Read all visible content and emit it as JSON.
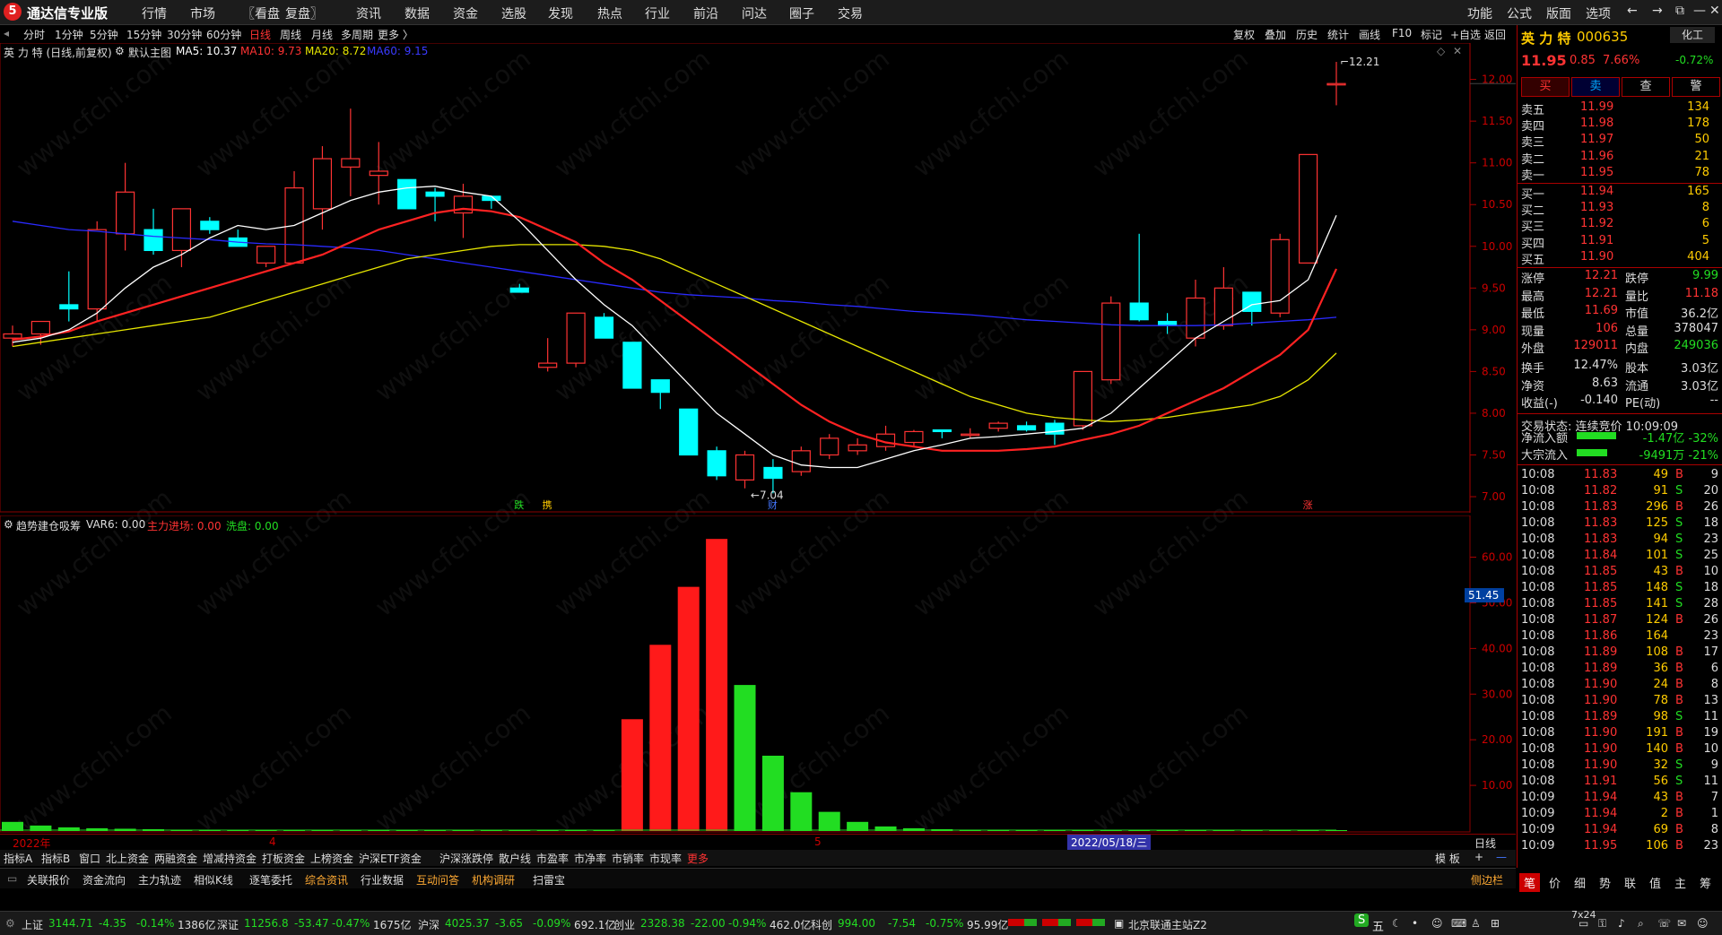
{
  "app": {
    "title": "通达信专业版",
    "logo_letter": "5"
  },
  "menu": [
    "行情",
    "市场",
    "〖看盘",
    "复盘〗",
    "资讯",
    "数据",
    "资金",
    "选股",
    "发现",
    "热点",
    "行业",
    "前沿",
    "问达",
    "圈子",
    "交易"
  ],
  "right_menu": [
    "功能",
    "公式",
    "版面",
    "选项"
  ],
  "window_controls": {
    "back": "←",
    "fwd": "→",
    "restore": "⧉",
    "min": "—",
    "max": "□",
    "close": "✕"
  },
  "periods": [
    "分时",
    "1分钟",
    "5分钟",
    "15分钟",
    "30分钟",
    "60分钟",
    "日线",
    "周线",
    "月线",
    "多周期",
    "更多 〉"
  ],
  "active_period": "日线",
  "toolbar_right": [
    "复权",
    "叠加",
    "历史",
    "统计",
    "画线",
    "F10",
    "标记",
    "+自选",
    "返回"
  ],
  "main_indicator": {
    "name": "英 力 特 (日线,前复权)",
    "template": "默认主图",
    "ma5": "MA5: 10.37",
    "ma10": "MA10: 9.73",
    "ma20": "MA20: 8.72",
    "ma60": "MA60: 9.15"
  },
  "colors": {
    "up": "#ff3333",
    "down": "#00ffff",
    "ma5": "#ffffff",
    "ma10": "#ff2222",
    "ma20": "#e6e600",
    "ma60": "#2a2aff",
    "vol_up": "#ff1a1a",
    "vol_down": "#22dd22",
    "accent": "#cc0000"
  },
  "chart_data": [
    {
      "type": "candlestick",
      "title": "英 力 特 (日线,前复权)",
      "ylim": [
        6.85,
        12.35
      ],
      "yticks": [
        7.0,
        7.5,
        8.0,
        8.5,
        9.0,
        9.5,
        10.0,
        10.5,
        11.0,
        11.5,
        12.0
      ],
      "ytick_labels": [
        "7.00",
        "7.50",
        "8.00",
        "8.50",
        "9.00",
        "9.50",
        "10.00",
        "10.50",
        "11.00",
        "11.50",
        "12.00"
      ],
      "annotations": [
        {
          "text": "12.21",
          "label": "high"
        },
        {
          "text": "←7.04",
          "label": "low"
        }
      ],
      "markers": [
        "跌",
        "携",
        "财",
        "涨"
      ],
      "x_labels": [
        "2022年",
        "4",
        "5",
        "2022/05/18/三"
      ],
      "candles": [
        {
          "o": 8.9,
          "h": 9.05,
          "l": 8.8,
          "c": 8.95
        },
        {
          "o": 8.95,
          "h": 9.05,
          "l": 8.82,
          "c": 9.1
        },
        {
          "o": 9.3,
          "h": 9.7,
          "l": 9.1,
          "c": 9.25
        },
        {
          "o": 9.25,
          "h": 10.3,
          "l": 9.1,
          "c": 10.2
        },
        {
          "o": 10.15,
          "h": 11.0,
          "l": 9.95,
          "c": 10.65
        },
        {
          "o": 10.2,
          "h": 10.45,
          "l": 9.9,
          "c": 9.95
        },
        {
          "o": 9.95,
          "h": 10.45,
          "l": 9.75,
          "c": 10.45
        },
        {
          "o": 10.3,
          "h": 10.35,
          "l": 10.15,
          "c": 10.2
        },
        {
          "o": 10.1,
          "h": 10.2,
          "l": 10.0,
          "c": 10.0
        },
        {
          "o": 9.8,
          "h": 10.0,
          "l": 9.75,
          "c": 10.0
        },
        {
          "o": 9.8,
          "h": 10.9,
          "l": 9.8,
          "c": 10.7
        },
        {
          "o": 10.45,
          "h": 11.2,
          "l": 10.2,
          "c": 11.05
        },
        {
          "o": 10.95,
          "h": 11.65,
          "l": 10.6,
          "c": 11.05
        },
        {
          "o": 10.85,
          "h": 11.25,
          "l": 10.5,
          "c": 10.9
        },
        {
          "o": 10.8,
          "h": 10.8,
          "l": 10.45,
          "c": 10.45
        },
        {
          "o": 10.65,
          "h": 10.7,
          "l": 10.3,
          "c": 10.6
        },
        {
          "o": 10.4,
          "h": 10.75,
          "l": 10.1,
          "c": 10.6
        },
        {
          "o": 10.6,
          "h": 10.6,
          "l": 10.45,
          "c": 10.55
        },
        {
          "o": 9.5,
          "h": 9.55,
          "l": 9.45,
          "c": 9.45
        },
        {
          "o": 8.55,
          "h": 8.9,
          "l": 8.5,
          "c": 8.6
        },
        {
          "o": 8.6,
          "h": 9.2,
          "l": 8.55,
          "c": 9.2
        },
        {
          "o": 9.15,
          "h": 9.2,
          "l": 8.9,
          "c": 8.9
        },
        {
          "o": 8.85,
          "h": 8.85,
          "l": 8.3,
          "c": 8.3
        },
        {
          "o": 8.4,
          "h": 8.4,
          "l": 8.05,
          "c": 8.25
        },
        {
          "o": 8.05,
          "h": 8.05,
          "l": 7.5,
          "c": 7.5
        },
        {
          "o": 7.55,
          "h": 7.6,
          "l": 7.2,
          "c": 7.25
        },
        {
          "o": 7.2,
          "h": 7.55,
          "l": 7.1,
          "c": 7.5
        },
        {
          "o": 7.35,
          "h": 7.45,
          "l": 7.04,
          "c": 7.22
        },
        {
          "o": 7.3,
          "h": 7.6,
          "l": 7.25,
          "c": 7.55
        },
        {
          "o": 7.5,
          "h": 7.75,
          "l": 7.45,
          "c": 7.7
        },
        {
          "o": 7.55,
          "h": 7.7,
          "l": 7.5,
          "c": 7.62
        },
        {
          "o": 7.6,
          "h": 7.85,
          "l": 7.55,
          "c": 7.75
        },
        {
          "o": 7.65,
          "h": 7.8,
          "l": 7.6,
          "c": 7.78
        },
        {
          "o": 7.8,
          "h": 7.8,
          "l": 7.7,
          "c": 7.78
        },
        {
          "o": 7.75,
          "h": 7.82,
          "l": 7.7,
          "c": 7.75
        },
        {
          "o": 7.82,
          "h": 7.9,
          "l": 7.78,
          "c": 7.88
        },
        {
          "o": 7.85,
          "h": 7.9,
          "l": 7.78,
          "c": 7.8
        },
        {
          "o": 7.88,
          "h": 7.92,
          "l": 7.62,
          "c": 7.75
        },
        {
          "o": 7.85,
          "h": 8.5,
          "l": 7.8,
          "c": 8.5
        },
        {
          "o": 8.4,
          "h": 9.4,
          "l": 8.35,
          "c": 9.32
        },
        {
          "o": 9.32,
          "h": 10.15,
          "l": 9.1,
          "c": 9.12
        },
        {
          "o": 9.1,
          "h": 9.2,
          "l": 8.95,
          "c": 9.05
        },
        {
          "o": 8.9,
          "h": 9.6,
          "l": 8.8,
          "c": 9.38
        },
        {
          "o": 9.05,
          "h": 9.75,
          "l": 9.0,
          "c": 9.5
        },
        {
          "o": 9.45,
          "h": 9.45,
          "l": 9.05,
          "c": 9.22
        },
        {
          "o": 9.2,
          "h": 10.15,
          "l": 9.15,
          "c": 10.08
        },
        {
          "o": 9.8,
          "h": 11.1,
          "l": 9.8,
          "c": 11.1
        },
        {
          "o": 11.95,
          "h": 12.21,
          "l": 11.69,
          "c": 11.95
        }
      ],
      "ma5": [
        8.85,
        8.9,
        9.0,
        9.2,
        9.5,
        9.75,
        9.9,
        10.1,
        10.25,
        10.2,
        10.25,
        10.4,
        10.55,
        10.65,
        10.7,
        10.72,
        10.65,
        10.6,
        10.3,
        9.95,
        9.6,
        9.3,
        9.05,
        8.7,
        8.35,
        8.0,
        7.75,
        7.5,
        7.38,
        7.35,
        7.35,
        7.45,
        7.55,
        7.62,
        7.7,
        7.72,
        7.75,
        7.78,
        7.82,
        8.0,
        8.3,
        8.6,
        8.9,
        9.1,
        9.3,
        9.35,
        9.6,
        10.37
      ],
      "ma10": [
        8.88,
        8.92,
        8.98,
        9.1,
        9.2,
        9.3,
        9.4,
        9.5,
        9.6,
        9.7,
        9.8,
        9.9,
        10.05,
        10.2,
        10.3,
        10.4,
        10.45,
        10.42,
        10.35,
        10.2,
        10.05,
        9.8,
        9.6,
        9.35,
        9.1,
        8.85,
        8.6,
        8.35,
        8.1,
        7.9,
        7.75,
        7.65,
        7.6,
        7.55,
        7.55,
        7.55,
        7.57,
        7.6,
        7.68,
        7.75,
        7.85,
        8.0,
        8.15,
        8.3,
        8.5,
        8.7,
        9.0,
        9.73
      ],
      "ma20": [
        8.8,
        8.85,
        8.9,
        8.95,
        9.0,
        9.05,
        9.1,
        9.15,
        9.25,
        9.35,
        9.45,
        9.55,
        9.65,
        9.75,
        9.85,
        9.9,
        9.95,
        10.0,
        10.02,
        10.02,
        10.02,
        10.0,
        9.95,
        9.85,
        9.7,
        9.55,
        9.4,
        9.25,
        9.1,
        8.95,
        8.8,
        8.65,
        8.5,
        8.35,
        8.2,
        8.1,
        8.0,
        7.95,
        7.92,
        7.9,
        7.92,
        7.95,
        8.0,
        8.05,
        8.1,
        8.2,
        8.4,
        8.72
      ],
      "ma60": [
        10.3,
        10.25,
        10.2,
        10.18,
        10.15,
        10.12,
        10.1,
        10.08,
        10.05,
        10.03,
        10.02,
        10.0,
        9.98,
        9.95,
        9.9,
        9.85,
        9.8,
        9.75,
        9.7,
        9.65,
        9.6,
        9.55,
        9.5,
        9.45,
        9.42,
        9.4,
        9.38,
        9.35,
        9.33,
        9.3,
        9.28,
        9.25,
        9.22,
        9.2,
        9.18,
        9.15,
        9.12,
        9.1,
        9.08,
        9.06,
        9.05,
        9.05,
        9.05,
        9.06,
        9.08,
        9.1,
        9.12,
        9.15
      ]
    },
    {
      "type": "bar",
      "title": "趋势建仓吸筹",
      "var6": "VAR6: 0.00",
      "main_force": "主力进场: 0.00",
      "wash": "洗盘: 0.00",
      "ylim": [
        0,
        66
      ],
      "yticks": [
        10,
        20,
        30,
        40,
        50,
        60
      ],
      "ytick_labels": [
        "10.00",
        "20.00",
        "30.00",
        "40.00",
        "50.00",
        "60.00"
      ],
      "current_label": "51.45",
      "values": [
        2.0,
        1.2,
        0.8,
        0.6,
        0.5,
        0.4,
        0.3,
        0.3,
        0.2,
        0.2,
        0.2,
        0.2,
        0.2,
        0.2,
        0.2,
        0.2,
        0.2,
        0.2,
        0.2,
        0.2,
        0.2,
        0.2,
        24.5,
        40.8,
        53.5,
        64.0,
        32.0,
        16.5,
        8.5,
        4.2,
        2.0,
        1.0,
        0.6,
        0.4,
        0.3,
        0.3,
        0.2,
        0.2,
        0.2,
        0.2,
        0.2,
        0.2,
        0.2,
        0.2,
        0.2,
        0.2,
        0.2,
        0.2
      ],
      "colors": [
        "g",
        "g",
        "g",
        "g",
        "g",
        "g",
        "g",
        "g",
        "g",
        "g",
        "g",
        "g",
        "g",
        "g",
        "g",
        "g",
        "g",
        "g",
        "g",
        "g",
        "g",
        "g",
        "r",
        "r",
        "r",
        "r",
        "g",
        "g",
        "g",
        "g",
        "g",
        "g",
        "g",
        "g",
        "g",
        "g",
        "g",
        "g",
        "g",
        "g",
        "g",
        "g",
        "g",
        "g",
        "g",
        "g",
        "g",
        "g"
      ]
    }
  ],
  "quote": {
    "name": "英 力 特",
    "code": "000635",
    "sector": "化工",
    "sector_change": "-0.72%",
    "price": "11.95",
    "change": "0.85",
    "pct": "7.66%",
    "buttons": [
      "买",
      "卖",
      "查",
      "警"
    ],
    "asks": [
      {
        "label": "卖五",
        "price": "11.99",
        "vol": "134"
      },
      {
        "label": "卖四",
        "price": "11.98",
        "vol": "178"
      },
      {
        "label": "卖三",
        "price": "11.97",
        "vol": "50"
      },
      {
        "label": "卖二",
        "price": "11.96",
        "vol": "21"
      },
      {
        "label": "卖一",
        "price": "11.95",
        "vol": "78"
      }
    ],
    "bids": [
      {
        "label": "买一",
        "price": "11.94",
        "vol": "165"
      },
      {
        "label": "买二",
        "price": "11.93",
        "vol": "8"
      },
      {
        "label": "买三",
        "price": "11.92",
        "vol": "6"
      },
      {
        "label": "买四",
        "price": "11.91",
        "vol": "5"
      },
      {
        "label": "买五",
        "price": "11.90",
        "vol": "404"
      }
    ],
    "stats": [
      {
        "k1": "涨停",
        "v1": "12.21",
        "c1": "red",
        "k2": "跌停",
        "v2": "9.99",
        "c2": "green"
      },
      {
        "k1": "最高",
        "v1": "12.21",
        "c1": "red",
        "k2": "量比",
        "v2": "11.18",
        "c2": "red"
      },
      {
        "k1": "最低",
        "v1": "11.69",
        "c1": "red",
        "k2": "市值",
        "v2": "36.2亿",
        "c2": "white"
      },
      {
        "k1": "现量",
        "v1": "106",
        "c1": "red",
        "k2": "总量",
        "v2": "378047",
        "c2": "white"
      },
      {
        "k1": "外盘",
        "v1": "129011",
        "c1": "red",
        "k2": "内盘",
        "v2": "249036",
        "c2": "green"
      },
      {
        "k1": "换手",
        "v1": "12.47%",
        "c1": "white",
        "k2": "股本",
        "v2": "3.03亿",
        "c2": "white"
      },
      {
        "k1": "净资",
        "v1": "8.63",
        "c1": "white",
        "k2": "流通",
        "v2": "3.03亿",
        "c2": "white"
      },
      {
        "k1": "收益(-)",
        "v1": "-0.140",
        "c1": "white",
        "k2": "PE(动)",
        "v2": "--",
        "c2": "white"
      }
    ],
    "trade_status": "交易状态: 连续竞价 10:09:09",
    "flow": [
      {
        "label": "净流入额",
        "value": "-1.47亿 -32%"
      },
      {
        "label": "大宗流入",
        "value": "-9491万 -21%"
      }
    ],
    "ticks": [
      {
        "t": "10:08",
        "p": "11.83",
        "v": "49",
        "s": "B",
        "n": "9"
      },
      {
        "t": "10:08",
        "p": "11.82",
        "v": "91",
        "s": "S",
        "n": "20"
      },
      {
        "t": "10:08",
        "p": "11.83",
        "v": "296",
        "s": "B",
        "n": "26"
      },
      {
        "t": "10:08",
        "p": "11.83",
        "v": "125",
        "s": "S",
        "n": "18"
      },
      {
        "t": "10:08",
        "p": "11.83",
        "v": "94",
        "s": "S",
        "n": "23"
      },
      {
        "t": "10:08",
        "p": "11.84",
        "v": "101",
        "s": "S",
        "n": "25"
      },
      {
        "t": "10:08",
        "p": "11.85",
        "v": "43",
        "s": "B",
        "n": "10"
      },
      {
        "t": "10:08",
        "p": "11.85",
        "v": "148",
        "s": "S",
        "n": "18"
      },
      {
        "t": "10:08",
        "p": "11.85",
        "v": "141",
        "s": "S",
        "n": "28"
      },
      {
        "t": "10:08",
        "p": "11.87",
        "v": "124",
        "s": "B",
        "n": "26"
      },
      {
        "t": "10:08",
        "p": "11.86",
        "v": "164",
        "s": "",
        "n": "23"
      },
      {
        "t": "10:08",
        "p": "11.89",
        "v": "108",
        "s": "B",
        "n": "17"
      },
      {
        "t": "10:08",
        "p": "11.89",
        "v": "36",
        "s": "B",
        "n": "6"
      },
      {
        "t": "10:08",
        "p": "11.90",
        "v": "24",
        "s": "B",
        "n": "8"
      },
      {
        "t": "10:08",
        "p": "11.90",
        "v": "78",
        "s": "B",
        "n": "13"
      },
      {
        "t": "10:08",
        "p": "11.89",
        "v": "98",
        "s": "S",
        "n": "11"
      },
      {
        "t": "10:08",
        "p": "11.90",
        "v": "191",
        "s": "B",
        "n": "19"
      },
      {
        "t": "10:08",
        "p": "11.90",
        "v": "140",
        "s": "B",
        "n": "10"
      },
      {
        "t": "10:08",
        "p": "11.90",
        "v": "32",
        "s": "S",
        "n": "9"
      },
      {
        "t": "10:08",
        "p": "11.91",
        "v": "56",
        "s": "S",
        "n": "11"
      },
      {
        "t": "10:09",
        "p": "11.94",
        "v": "43",
        "s": "B",
        "n": "7"
      },
      {
        "t": "10:09",
        "p": "11.94",
        "v": "2",
        "s": "B",
        "n": "1"
      },
      {
        "t": "10:09",
        "p": "11.94",
        "v": "69",
        "s": "B",
        "n": "8"
      },
      {
        "t": "10:09",
        "p": "11.95",
        "v": "106",
        "s": "B",
        "n": "23"
      }
    ],
    "right_tabs": [
      "笔",
      "价",
      "细",
      "势",
      "联",
      "值",
      "主",
      "筹"
    ]
  },
  "bottom_tabs1": [
    "指标A",
    "指标B",
    "窗口",
    "北上资金",
    "两融资金",
    "增减持资金",
    "打板资金",
    "上榜资金",
    "沪深ETF资金",
    "沪深涨跌停",
    "散户线",
    "市盈率",
    "市净率",
    "市销率",
    "市现率",
    "更多"
  ],
  "bottom_tabs1_right": [
    "模 板",
    "+",
    "—",
    "日线"
  ],
  "bottom_tabs2": [
    "关联报价",
    "资金流向",
    "主力轨迹",
    "相似K线",
    "逐笔委托",
    "综合资讯",
    "行业数据",
    "互动问答",
    "机构调研",
    "扫雷宝"
  ],
  "bottom_tabs2_right": "侧边栏",
  "status": {
    "sh": {
      "name": "上证",
      "val": "3144.71",
      "chg": "-4.35",
      "pct": "-0.14%",
      "amt": "1386亿"
    },
    "sz": {
      "name": "深证",
      "val": "11256.8",
      "chg": "-53.47",
      "pct": "-0.47%",
      "amt": "1675亿"
    },
    "hs": {
      "name": "沪深",
      "val": "4025.37",
      "chg": "-3.65",
      "pct": "-0.09%",
      "amt": "692.1亿"
    },
    "cy": {
      "name": "创业",
      "val": "2328.38",
      "chg": "-22.00",
      "pct": "-0.94%",
      "amt": "462.0亿"
    },
    "kc": {
      "name": "科创",
      "val": "994.00",
      "chg": "-7.54",
      "pct": "-0.75%",
      "amt": "95.99亿"
    },
    "server": "北京联通主站Z2",
    "mode": "7x24",
    "ime": "五"
  },
  "watermark": "www.cfchi.com"
}
